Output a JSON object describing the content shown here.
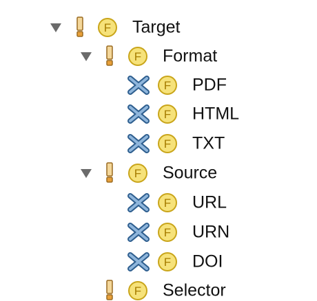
{
  "tree": {
    "nodes": [
      {
        "label": "Target",
        "kind": "feature",
        "status": "selected",
        "expanded": true,
        "warning": true
      },
      {
        "label": "Format",
        "kind": "feature",
        "expanded": true,
        "warning": true
      },
      {
        "label": "PDF",
        "kind": "alternative",
        "marker": "cross"
      },
      {
        "label": "HTML",
        "kind": "alternative",
        "marker": "cross"
      },
      {
        "label": "TXT",
        "kind": "alternative",
        "marker": "cross"
      },
      {
        "label": "Source",
        "kind": "feature",
        "expanded": true,
        "warning": true
      },
      {
        "label": "URL",
        "kind": "alternative",
        "marker": "cross"
      },
      {
        "label": "URN",
        "kind": "alternative",
        "marker": "cross"
      },
      {
        "label": "DOI",
        "kind": "alternative",
        "marker": "cross"
      },
      {
        "label": "Selector",
        "kind": "feature",
        "expanded": false,
        "warning": true
      }
    ],
    "feature_badge_letter": "F",
    "colors": {
      "selection": "#dcdcdc",
      "feature_badge_fill": "#f6e27a",
      "feature_badge_stroke": "#c9a51a",
      "warning": "#e8a03a",
      "cross": "#4a7aa8"
    },
    "icons": {
      "twisty": "chevron-down-icon",
      "warning": "exclamation-icon",
      "feature": "feature-f-icon",
      "cross": "cross-icon"
    }
  }
}
